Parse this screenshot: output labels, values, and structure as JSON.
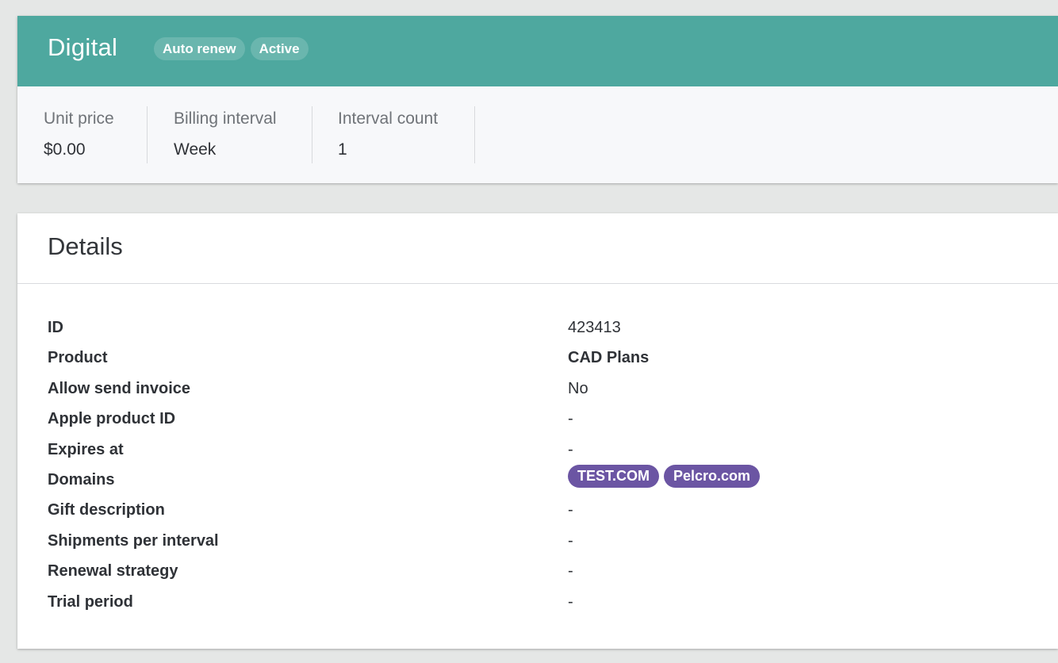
{
  "plan": {
    "title": "Digital",
    "badges": [
      "Auto renew",
      "Active"
    ],
    "header_color": "#4ea89f",
    "stats": [
      {
        "label": "Unit price",
        "value": "$0.00"
      },
      {
        "label": "Billing interval",
        "value": "Week"
      },
      {
        "label": "Interval count",
        "value": "1"
      }
    ]
  },
  "details": {
    "title": "Details",
    "rows": [
      {
        "key": "ID",
        "value": "423413"
      },
      {
        "key": "Product",
        "value": "CAD Plans"
      },
      {
        "key": "Allow send invoice",
        "value": "No"
      },
      {
        "key": "Apple product ID",
        "value": "-"
      },
      {
        "key": "Expires at",
        "value": "-"
      },
      {
        "key": "Domains",
        "chips": [
          "TEST.COM",
          "Pelcro.com"
        ]
      },
      {
        "key": "Gift description",
        "value": "-"
      },
      {
        "key": "Shipments per interval",
        "value": "-"
      },
      {
        "key": "Renewal strategy",
        "value": "-"
      },
      {
        "key": "Trial period",
        "value": "-"
      }
    ],
    "chip_color": "#6b55a3"
  }
}
